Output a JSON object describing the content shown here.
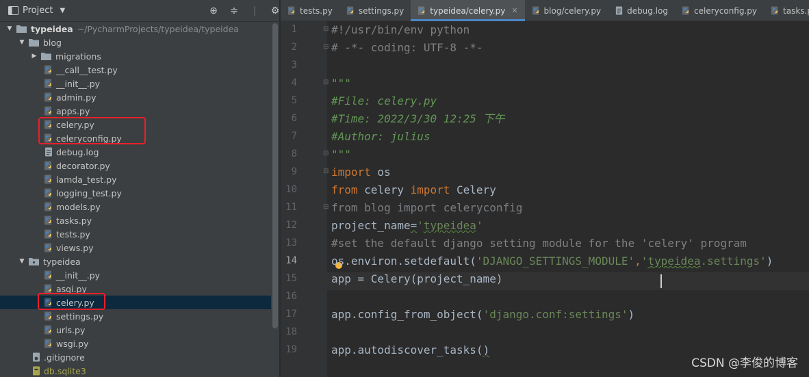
{
  "project_panel": {
    "title": "Project",
    "root": {
      "name": "typeidea",
      "path": "~/PycharmProjects/typeidea/typeidea"
    },
    "tree": [
      {
        "label": "blog",
        "type": "folder",
        "depth": 1,
        "expanded": true
      },
      {
        "label": "migrations",
        "type": "folder",
        "depth": 2,
        "expanded": false
      },
      {
        "label": "__call__test.py",
        "type": "py",
        "depth": 2
      },
      {
        "label": "__init__.py",
        "type": "py",
        "depth": 2
      },
      {
        "label": "admin.py",
        "type": "py",
        "depth": 2
      },
      {
        "label": "apps.py",
        "type": "py",
        "depth": 2
      },
      {
        "label": "celery.py",
        "type": "py",
        "depth": 2
      },
      {
        "label": "celeryconfig.py",
        "type": "py",
        "depth": 2
      },
      {
        "label": "debug.log",
        "type": "log",
        "depth": 2
      },
      {
        "label": "decorator.py",
        "type": "py",
        "depth": 2
      },
      {
        "label": "lamda_test.py",
        "type": "py",
        "depth": 2
      },
      {
        "label": "logging_test.py",
        "type": "py",
        "depth": 2
      },
      {
        "label": "models.py",
        "type": "py",
        "depth": 2
      },
      {
        "label": "tasks.py",
        "type": "py",
        "depth": 2
      },
      {
        "label": "tests.py",
        "type": "py",
        "depth": 2
      },
      {
        "label": "views.py",
        "type": "py",
        "depth": 2
      },
      {
        "label": "typeidea",
        "type": "folder",
        "depth": 1,
        "expanded": true
      },
      {
        "label": "__init__.py",
        "type": "py",
        "depth": 2
      },
      {
        "label": "asgi.py",
        "type": "py",
        "depth": 2
      },
      {
        "label": "celery.py",
        "type": "py",
        "depth": 2,
        "selected": true
      },
      {
        "label": "settings.py",
        "type": "py",
        "depth": 2
      },
      {
        "label": "urls.py",
        "type": "py",
        "depth": 2
      },
      {
        "label": "wsgi.py",
        "type": "py",
        "depth": 2
      },
      {
        "label": ".gitignore",
        "type": "git",
        "depth": 1
      },
      {
        "label": "db.sqlite3",
        "type": "db",
        "depth": 1
      }
    ]
  },
  "tabs": [
    {
      "label": "tests.py",
      "icon": "python-file-icon",
      "active": false
    },
    {
      "label": "settings.py",
      "icon": "python-file-icon",
      "active": false
    },
    {
      "label": "typeidea/celery.py",
      "icon": "python-file-icon",
      "active": true
    },
    {
      "label": "blog/celery.py",
      "icon": "python-file-icon",
      "active": false
    },
    {
      "label": "debug.log",
      "icon": "text-file-icon",
      "active": false
    },
    {
      "label": "celeryconfig.py",
      "icon": "python-file-icon",
      "active": false
    },
    {
      "label": "tasks.py",
      "icon": "python-file-icon",
      "active": false
    }
  ],
  "editor": {
    "current_line": 14,
    "lines": [
      {
        "n": "1",
        "tokens": [
          [
            "#!/usr/bin/env python",
            "cmt"
          ]
        ]
      },
      {
        "n": "2",
        "tokens": [
          [
            "# -*- coding: UTF-8 -*-",
            "cmt"
          ]
        ]
      },
      {
        "n": "3",
        "tokens": []
      },
      {
        "n": "4",
        "tokens": [
          [
            "\"\"\"",
            "doc"
          ]
        ]
      },
      {
        "n": "5",
        "tokens": [
          [
            "#File: celery.py",
            "doc"
          ]
        ]
      },
      {
        "n": "6",
        "tokens": [
          [
            "#Time: 2022/3/30 12:25 下午",
            "doc"
          ]
        ]
      },
      {
        "n": "7",
        "tokens": [
          [
            "#Author: julius",
            "doc"
          ]
        ]
      },
      {
        "n": "8",
        "tokens": [
          [
            "\"\"\"",
            "doc"
          ]
        ]
      },
      {
        "n": "9",
        "tokens": [
          [
            "import",
            "kw"
          ],
          [
            " os",
            ""
          ]
        ]
      },
      {
        "n": "10",
        "tokens": [
          [
            "from",
            "kw"
          ],
          [
            " celery ",
            ""
          ],
          [
            "import",
            "kw"
          ],
          [
            " Celery",
            ""
          ]
        ]
      },
      {
        "n": "11",
        "tokens": [
          [
            "from blog import celeryconfig",
            "gray"
          ]
        ]
      },
      {
        "n": "12",
        "tokens": [
          [
            "project_name",
            ""
          ],
          [
            "=",
            "squig"
          ],
          [
            "'",
            "str"
          ],
          [
            "typeidea",
            "str squig"
          ],
          [
            "'",
            "str"
          ]
        ]
      },
      {
        "n": "13",
        "tokens": [
          [
            "#set the default django setting module for the 'celery' program",
            "cmt"
          ]
        ]
      },
      {
        "n": "14",
        "tokens": [
          [
            "os.environ.setdefault(",
            ""
          ],
          [
            "'DJANGO_SETTINGS_MODULE'",
            "str"
          ],
          [
            ",",
            "kw"
          ],
          [
            "'",
            "str"
          ],
          [
            "typeidea",
            "str squig"
          ],
          [
            ".settings'",
            "str"
          ],
          [
            ")",
            ""
          ]
        ]
      },
      {
        "n": "15",
        "tokens": [
          [
            "app = Celery(project_name)",
            ""
          ]
        ]
      },
      {
        "n": "16",
        "tokens": []
      },
      {
        "n": "17",
        "tokens": [
          [
            "app.config_from_object(",
            ""
          ],
          [
            "'django.conf:settings'",
            "str"
          ],
          [
            ")",
            ""
          ]
        ]
      },
      {
        "n": "18",
        "tokens": []
      },
      {
        "n": "19",
        "tokens": [
          [
            "app.autodiscover_tasks(",
            ""
          ],
          [
            ")",
            "squig"
          ]
        ]
      }
    ]
  },
  "watermark": "CSDN @李俊的博客",
  "colors": {
    "python_icon_blue": "#4a86c5",
    "python_icon_yellow": "#f2c55c",
    "highlight_box": "#e8202b",
    "selection": "#0d293e"
  }
}
